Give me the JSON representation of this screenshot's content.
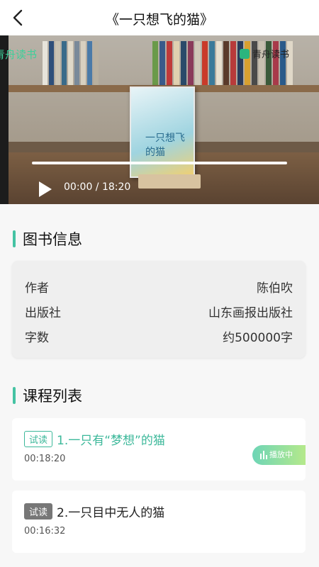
{
  "header": {
    "title": "《一只想飞的猫》",
    "back_icon": "back-arrow-icon"
  },
  "video": {
    "watermark_left": "青舟读书",
    "watermark_right": "青舟读书",
    "book_cover_text": "一只想飞的猫",
    "time_display": "00:00 / 18:20",
    "progress": 0
  },
  "book_info": {
    "heading": "图书信息",
    "rows": [
      {
        "label": "作者",
        "value": "陈伯吹"
      },
      {
        "label": "出版社",
        "value": "山东画报出版社"
      },
      {
        "label": "字数",
        "value": "约500000字"
      }
    ]
  },
  "course_list": {
    "heading": "课程列表",
    "items": [
      {
        "tag": "试读",
        "title": "1.一只有“梦想”的猫",
        "duration": "00:18:20",
        "playing": true
      },
      {
        "tag": "试读",
        "title": "2.一只目中无人的猫",
        "duration": "00:16:32",
        "playing": false
      }
    ],
    "playing_label": "播放中"
  },
  "colors": {
    "accent": "#45c3a3",
    "tag_gray": "#777777"
  }
}
